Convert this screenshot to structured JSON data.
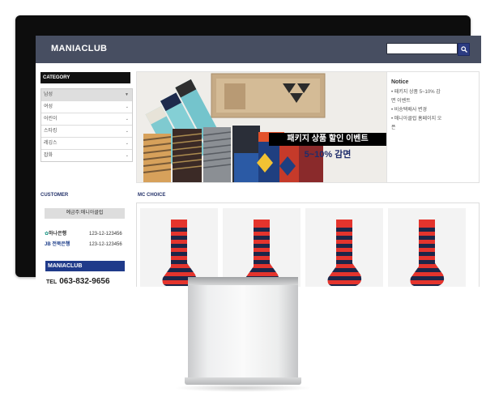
{
  "header": {
    "logo": "MANIACLUB",
    "search_placeholder": ""
  },
  "category": {
    "title": "CATEGORY",
    "items": [
      {
        "label": "남성",
        "active": true
      },
      {
        "label": "여성",
        "active": false
      },
      {
        "label": "어린이",
        "active": false
      },
      {
        "label": "스타킹",
        "active": false
      },
      {
        "label": "레깅스",
        "active": false
      },
      {
        "label": "잡화",
        "active": false
      }
    ]
  },
  "banner": {
    "badge_text": "패키지 상품 할인 이벤트",
    "discount_text": "5~10% 감면"
  },
  "notice": {
    "title": "Notice",
    "items": [
      "• 패키지 상품 5~10% 감",
      "  면 이벤트",
      "• 비송택배사 변경",
      "• 매니아클럽 홈페이지 오",
      "  픈"
    ]
  },
  "customer": {
    "title": "CUSTOMER",
    "bank_label": "예금주:매니아클럽",
    "banks": [
      {
        "name": "하나은행",
        "account": "123-12-123456"
      },
      {
        "name": "JB 전북은행",
        "account": "123-12-123456"
      }
    ],
    "logo_text": "MANIACLUB",
    "tel_label": "TEL",
    "tel": "063-832-9656"
  },
  "choice": {
    "title": "MC CHOICE",
    "product_count": 4
  },
  "colors": {
    "header_bg": "#474e61",
    "brand_blue": "#1f3a8a",
    "sock_red": "#e4342d",
    "sock_navy": "#1c2649"
  }
}
